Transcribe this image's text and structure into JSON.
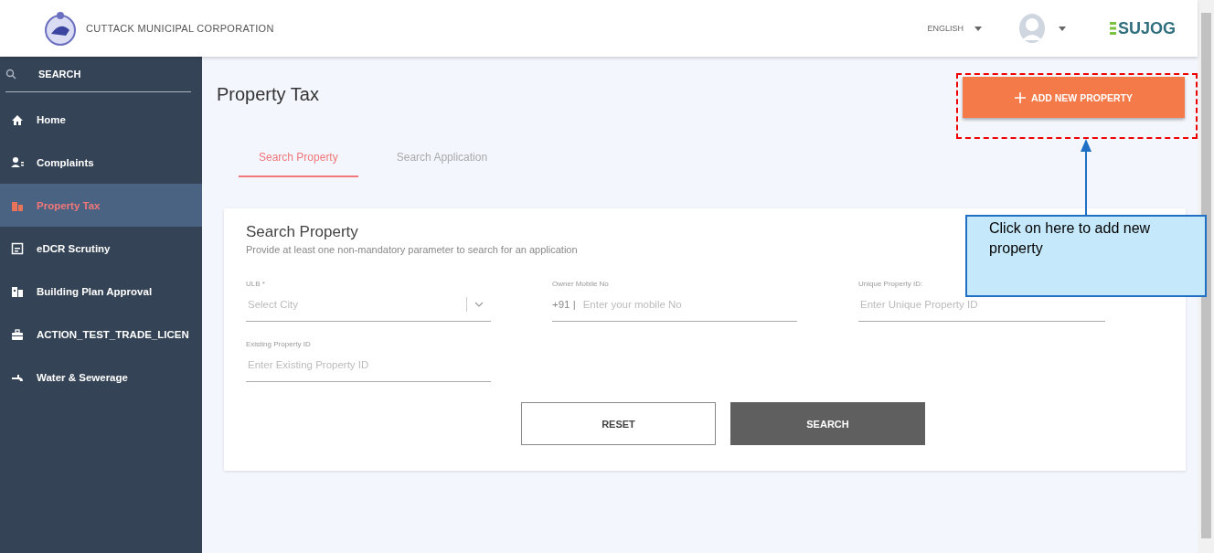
{
  "header": {
    "organization": "CUTTACK MUNICIPAL CORPORATION",
    "language": "ENGLISH",
    "brand": "SUJOG"
  },
  "sidebar": {
    "search_label": "SEARCH",
    "items": [
      {
        "label": "Home",
        "selected": false
      },
      {
        "label": "Complaints",
        "selected": false
      },
      {
        "label": "Property Tax",
        "selected": true
      },
      {
        "label": "eDCR Scrutiny",
        "selected": false
      },
      {
        "label": "Building Plan Approval",
        "selected": false
      },
      {
        "label": "ACTION_TEST_TRADE_LICEN",
        "selected": false
      },
      {
        "label": "Water & Sewerage",
        "selected": false
      }
    ]
  },
  "page_title": "Property Tax",
  "add_button": "ADD NEW PROPERTY",
  "tabs": [
    {
      "label": "Search Property",
      "selected": true
    },
    {
      "label": "Search Application",
      "selected": false
    }
  ],
  "card": {
    "title": "Search Property",
    "subtitle": "Provide at least one non-mandatory parameter to search for an application",
    "fields": [
      {
        "kind": "select",
        "label": "ULB *",
        "placeholder": "Select City"
      },
      {
        "kind": "phone",
        "label": "Owner Mobile No",
        "prefix": "+91 |",
        "placeholder": "Enter your mobile No"
      },
      {
        "kind": "text",
        "label": "Unique Property ID:",
        "placeholder": "Enter Unique Property ID"
      },
      {
        "kind": "text",
        "label": "Existing Property ID",
        "placeholder": "Enter Existing Property ID"
      }
    ],
    "buttons": [
      {
        "kind": "secondary",
        "label": "RESET"
      },
      {
        "kind": "primary",
        "label": "SEARCH"
      }
    ]
  },
  "annotation": {
    "text": "Click on here to add new property"
  }
}
